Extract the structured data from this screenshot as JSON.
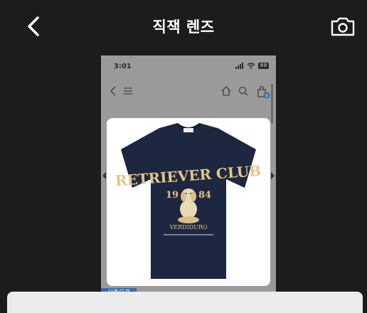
{
  "header": {
    "title": "직잭 렌즈",
    "back_icon": "chevron-left-icon",
    "camera_icon": "camera-icon"
  },
  "preview": {
    "status_time": "3:01",
    "battery_level": "88",
    "nav_icons": [
      "chevron-left-icon",
      "menu-icon",
      "home-icon",
      "search-icon",
      "shopping-bag-icon"
    ],
    "cart_count": "0",
    "product": {
      "brand_text": "RETRIEVER CLUB",
      "year_left": "19",
      "year_right": "84",
      "sub_text": "VERDIDURO",
      "shirt_color": "#1e2740",
      "print_color": "#e2c785"
    },
    "badge": "시즌오프"
  }
}
